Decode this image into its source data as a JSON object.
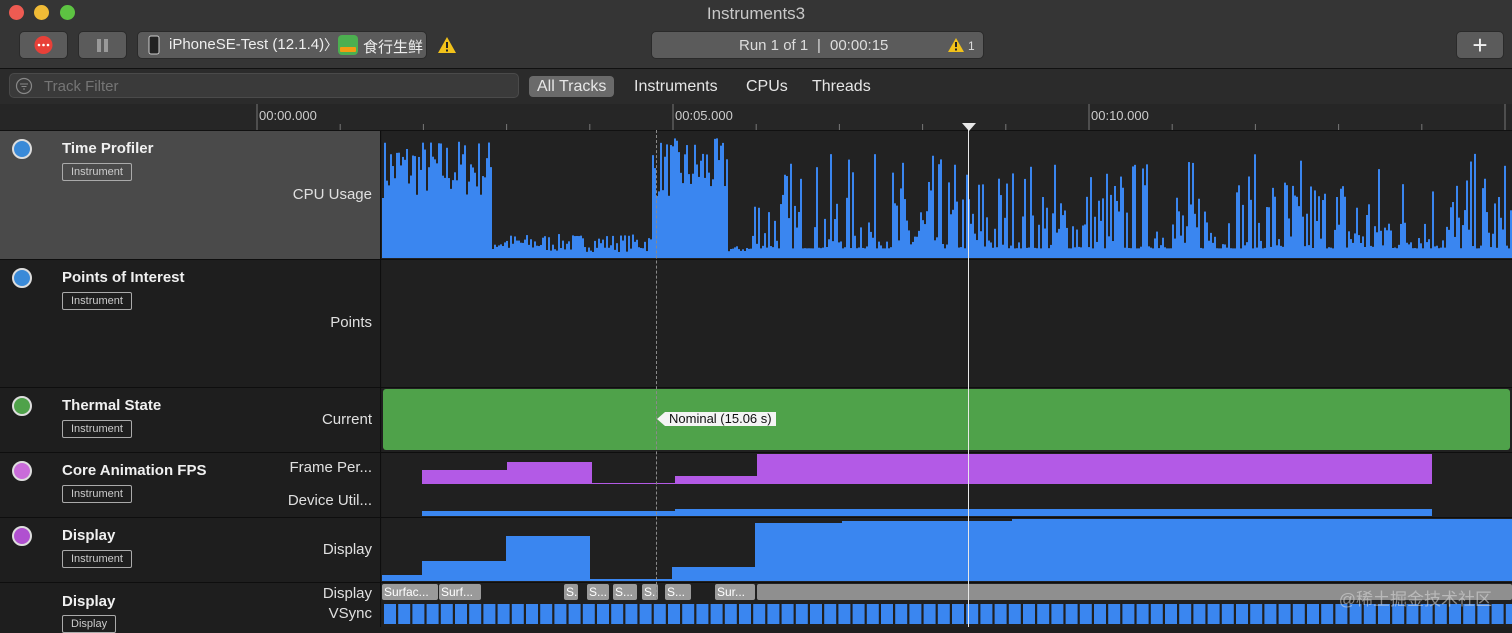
{
  "window": {
    "title": "Instruments3"
  },
  "toolbar": {
    "device_name": "iPhoneSE-Test (12.1.4)",
    "device_separator": "〉",
    "app_name": "食行生鲜",
    "run_label": "Run 1 of 1",
    "run_separator": "|",
    "elapsed": "00:00:15",
    "warning_count": "1",
    "add_label": "+"
  },
  "filter": {
    "placeholder": "Track Filter",
    "tabs": [
      "All Tracks",
      "Instruments",
      "CPUs",
      "Threads"
    ],
    "selected": "All Tracks"
  },
  "ruler": {
    "ticks": [
      "00:00.000",
      "00:05.000",
      "00:10.000"
    ]
  },
  "tracks": [
    {
      "name": "Time Profiler",
      "tag": "Instrument",
      "sub": [
        "CPU Usage"
      ]
    },
    {
      "name": "Points of Interest",
      "tag": "Instrument",
      "sub": [
        "Points"
      ]
    },
    {
      "name": "Thermal State",
      "tag": "Instrument",
      "sub": [
        "Current"
      ],
      "bar_label": "Nominal (15.06 s)"
    },
    {
      "name": "Core Animation FPS",
      "tag": "Instrument",
      "sub": [
        "Frame Per...",
        "Device Util..."
      ]
    },
    {
      "name": "Display",
      "tag": "Instrument",
      "sub": [
        "Display"
      ]
    },
    {
      "name": "Display",
      "tag": "Display",
      "sub": [
        "Display",
        "VSync"
      ],
      "chips": [
        "Surfac...",
        "Surf...",
        "S.",
        "S...",
        "S...",
        "S.",
        "S...",
        "Sur..."
      ]
    }
  ],
  "colors": {
    "cpu": "#3a86f0",
    "thermal": "#4fa24a",
    "fps": "#b35ae6",
    "display": "#3a86f0",
    "vsync": "#3a86f0"
  },
  "watermark": "@稀土掘金技术社区"
}
